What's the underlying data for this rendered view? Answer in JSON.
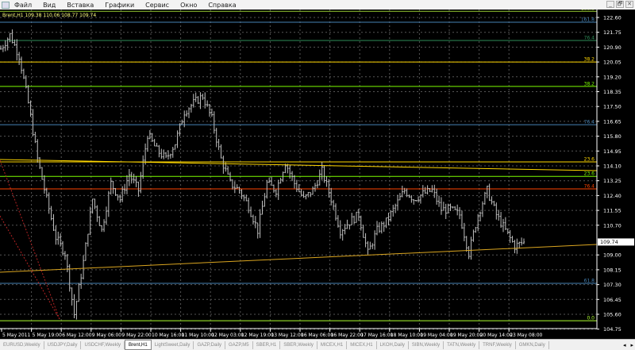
{
  "menu": [
    "Файл",
    "Вид",
    "Вставка",
    "Графики",
    "Сервис",
    "Окно",
    "Справка"
  ],
  "window_buttons": [
    "_",
    "🗗",
    "✕"
  ],
  "chart_header": "Brent,H1  109.38 110.06 108.77 109.74",
  "current_price": "109.74",
  "colors": {
    "bg": "#000000",
    "bars": "#c0c0c0",
    "grid": "#5a5a5a",
    "axis": "#ffffff"
  },
  "price_axis": [
    "122.60",
    "121.75",
    "120.90",
    "120.05",
    "119.20",
    "118.35",
    "117.50",
    "116.65",
    "115.80",
    "114.95",
    "114.10",
    "113.25",
    "112.40",
    "111.55",
    "110.70",
    "109.00",
    "108.15",
    "107.30",
    "106.45",
    "105.60",
    "104.75"
  ],
  "time_axis": [
    "5 May 2011",
    "5 May 19:00",
    "6 May 12:00",
    "9 May 06:00",
    "9 May 22:00",
    "10 May 16:00",
    "11 May 10:00",
    "12 May 03:00",
    "12 May 19:00",
    "13 May 12:00",
    "16 May 06:00",
    "16 May 22:00",
    "17 May 16:00",
    "18 May 10:00",
    "19 May 04:00",
    "19 May 20:00",
    "20 May 14:00",
    "23 May 08:00"
  ],
  "fib_levels": [
    {
      "label": "100.0",
      "price": 122.95,
      "color": "#9acd32"
    },
    {
      "label": "161.8",
      "price": 122.33,
      "color": "#4682b4"
    },
    {
      "label": "76.4",
      "price": 121.28,
      "color": "#2e8b57"
    },
    {
      "label": "38.2",
      "price": 120.05,
      "color": "#ffd700"
    },
    {
      "label": "38.2",
      "price": 118.65,
      "color": "#7cfc00"
    },
    {
      "label": "76.4",
      "price": 116.46,
      "color": "#4682b4"
    },
    {
      "label": "23.6",
      "price": 114.33,
      "color": "#ffd700"
    },
    {
      "label": "23.6",
      "price": 113.5,
      "color": "#7cfc00"
    },
    {
      "label": "76.4",
      "price": 112.78,
      "color": "#ff4500"
    },
    {
      "label": "61.8",
      "price": 107.37,
      "color": "#4682b4"
    },
    {
      "label": "0.0",
      "price": 105.23,
      "color": "#adff2f"
    }
  ],
  "tabs": [
    {
      "label": "EURUSD,Weekly"
    },
    {
      "label": "USDJPY,Daily"
    },
    {
      "label": "USDCHF,Weekly"
    },
    {
      "label": "Brent,H1",
      "active": true
    },
    {
      "label": "LightSweet,Daily"
    },
    {
      "label": "GAZP,Daily"
    },
    {
      "label": "GAZP,M5"
    },
    {
      "label": "SBER,H1"
    },
    {
      "label": "SBER,Weekly"
    },
    {
      "label": "MICEX,H1"
    },
    {
      "label": "MICEX,H1"
    },
    {
      "label": "LKOH,Daily"
    },
    {
      "label": "SIBN,Weekly"
    },
    {
      "label": "TATN,Weekly"
    },
    {
      "label": "TRNF,Weekly"
    },
    {
      "label": "GMKN,Daily"
    }
  ],
  "tab_nav": [
    "◂",
    "▸"
  ],
  "chart_data": {
    "type": "ohlc",
    "symbol": "Brent",
    "timeframe": "H1",
    "ylim": [
      104.75,
      122.95
    ],
    "close_path": [
      120.8,
      121.6,
      120.4,
      117.7,
      114.5,
      112.2,
      110,
      109.1,
      105.6,
      108.6,
      112.2,
      110.4,
      113.1,
      112.2,
      113.6,
      112.7,
      115.9,
      115,
      114.5,
      115.4,
      117.2,
      117.7,
      118.1,
      116.8,
      114.5,
      113.1,
      112.7,
      111.8,
      110.4,
      113.1,
      112.7,
      114.3,
      113.1,
      112.2,
      112.7,
      113.8,
      112.2,
      110.4,
      110.9,
      111.3,
      109.1,
      110.4,
      110.9,
      111.8,
      112.7,
      112.2,
      112.5,
      112.7,
      111.6,
      111.6,
      111.3,
      109.1,
      111.3,
      112.7,
      111.3,
      110.4,
      109.5,
      109.74
    ]
  }
}
